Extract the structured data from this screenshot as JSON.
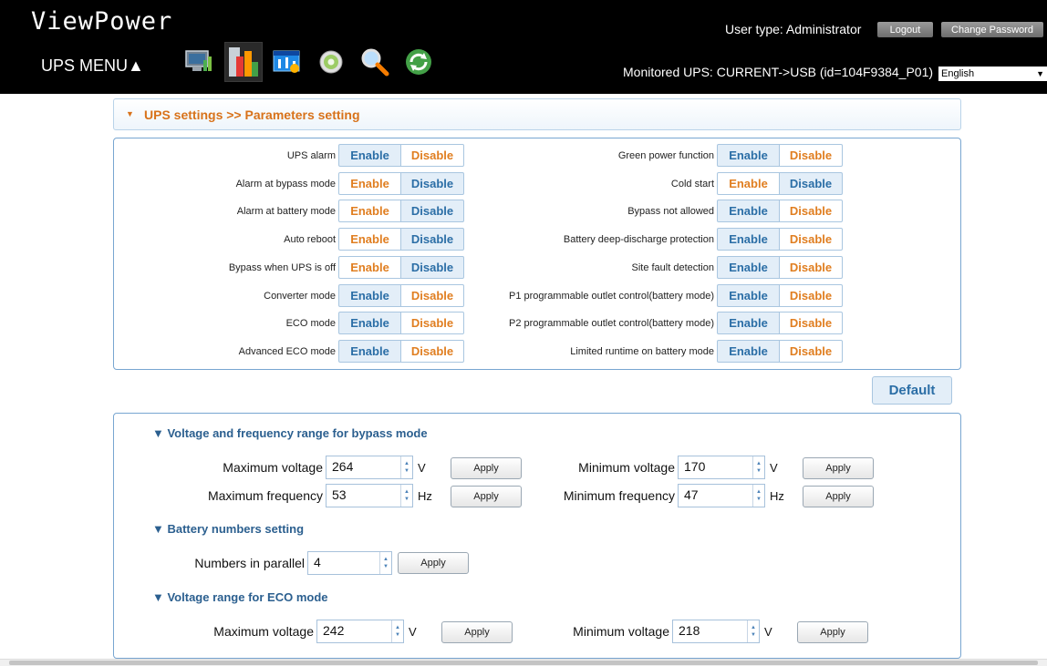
{
  "header": {
    "logo": "ViewPower",
    "menu_label": "UPS MENU▲",
    "user_type": "User type: Administrator",
    "logout": "Logout",
    "change_password": "Change Password",
    "monitored": "Monitored UPS: CURRENT->USB (id=104F9384_P01)",
    "language": "English",
    "toolbar_icons": [
      "monitor-icon",
      "chart-icon",
      "settings-icon",
      "gear-icon",
      "search-icon",
      "refresh-icon"
    ]
  },
  "breadcrumb": "UPS settings >> Parameters setting",
  "params": {
    "enable_label": "Enable",
    "disable_label": "Disable",
    "left": [
      {
        "label": "UPS alarm",
        "selected": "disable"
      },
      {
        "label": "Alarm at bypass mode",
        "selected": "enable"
      },
      {
        "label": "Alarm at battery mode",
        "selected": "enable"
      },
      {
        "label": "Auto reboot",
        "selected": "enable"
      },
      {
        "label": "Bypass when UPS is off",
        "selected": "enable"
      },
      {
        "label": "Converter mode",
        "selected": "disable"
      },
      {
        "label": "ECO mode",
        "selected": "disable"
      },
      {
        "label": "Advanced ECO mode",
        "selected": "disable"
      }
    ],
    "right": [
      {
        "label": "Green power function",
        "selected": "disable"
      },
      {
        "label": "Cold start",
        "selected": "enable"
      },
      {
        "label": "Bypass not allowed",
        "selected": "disable"
      },
      {
        "label": "Battery deep-discharge protection",
        "selected": "disable"
      },
      {
        "label": "Site fault detection",
        "selected": "disable"
      },
      {
        "label": "P1 programmable outlet control(battery mode)",
        "selected": "disable"
      },
      {
        "label": "P2 programmable outlet control(battery mode)",
        "selected": "disable"
      },
      {
        "label": "Limited runtime on battery mode",
        "selected": "disable"
      }
    ]
  },
  "default_button": "Default",
  "apply_label": "Apply",
  "bypass": {
    "title": "▼ Voltage and frequency range for bypass mode",
    "max_voltage": {
      "label": "Maximum voltage",
      "value": "264",
      "unit": "V"
    },
    "min_voltage": {
      "label": "Minimum voltage",
      "value": "170",
      "unit": "V"
    },
    "max_freq": {
      "label": "Maximum frequency",
      "value": "53",
      "unit": "Hz"
    },
    "min_freq": {
      "label": "Minimum frequency",
      "value": "47",
      "unit": "Hz"
    }
  },
  "battery": {
    "title": "▼ Battery numbers setting",
    "parallel": {
      "label": "Numbers in parallel",
      "value": "4"
    }
  },
  "eco": {
    "title": "▼ Voltage range for ECO mode",
    "max_voltage": {
      "label": "Maximum voltage",
      "value": "242",
      "unit": "V"
    },
    "min_voltage": {
      "label": "Minimum voltage",
      "value": "218",
      "unit": "V"
    }
  }
}
